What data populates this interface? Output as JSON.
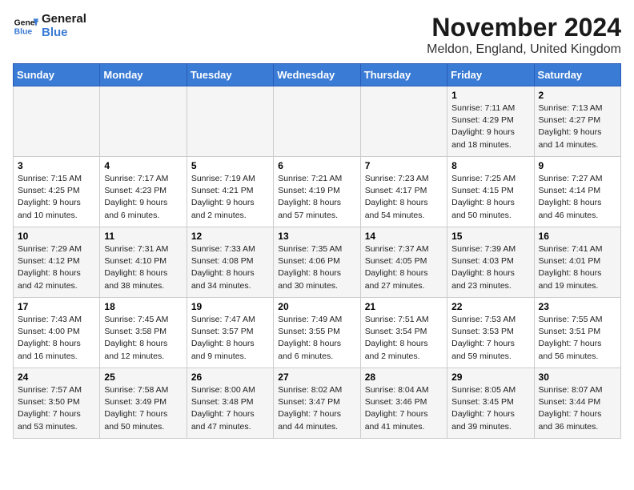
{
  "header": {
    "logo_line1": "General",
    "logo_line2": "Blue",
    "month": "November 2024",
    "location": "Meldon, England, United Kingdom"
  },
  "days_of_week": [
    "Sunday",
    "Monday",
    "Tuesday",
    "Wednesday",
    "Thursday",
    "Friday",
    "Saturday"
  ],
  "weeks": [
    [
      {
        "day": "",
        "info": ""
      },
      {
        "day": "",
        "info": ""
      },
      {
        "day": "",
        "info": ""
      },
      {
        "day": "",
        "info": ""
      },
      {
        "day": "",
        "info": ""
      },
      {
        "day": "1",
        "info": "Sunrise: 7:11 AM\nSunset: 4:29 PM\nDaylight: 9 hours\nand 18 minutes."
      },
      {
        "day": "2",
        "info": "Sunrise: 7:13 AM\nSunset: 4:27 PM\nDaylight: 9 hours\nand 14 minutes."
      }
    ],
    [
      {
        "day": "3",
        "info": "Sunrise: 7:15 AM\nSunset: 4:25 PM\nDaylight: 9 hours\nand 10 minutes."
      },
      {
        "day": "4",
        "info": "Sunrise: 7:17 AM\nSunset: 4:23 PM\nDaylight: 9 hours\nand 6 minutes."
      },
      {
        "day": "5",
        "info": "Sunrise: 7:19 AM\nSunset: 4:21 PM\nDaylight: 9 hours\nand 2 minutes."
      },
      {
        "day": "6",
        "info": "Sunrise: 7:21 AM\nSunset: 4:19 PM\nDaylight: 8 hours\nand 57 minutes."
      },
      {
        "day": "7",
        "info": "Sunrise: 7:23 AM\nSunset: 4:17 PM\nDaylight: 8 hours\nand 54 minutes."
      },
      {
        "day": "8",
        "info": "Sunrise: 7:25 AM\nSunset: 4:15 PM\nDaylight: 8 hours\nand 50 minutes."
      },
      {
        "day": "9",
        "info": "Sunrise: 7:27 AM\nSunset: 4:14 PM\nDaylight: 8 hours\nand 46 minutes."
      }
    ],
    [
      {
        "day": "10",
        "info": "Sunrise: 7:29 AM\nSunset: 4:12 PM\nDaylight: 8 hours\nand 42 minutes."
      },
      {
        "day": "11",
        "info": "Sunrise: 7:31 AM\nSunset: 4:10 PM\nDaylight: 8 hours\nand 38 minutes."
      },
      {
        "day": "12",
        "info": "Sunrise: 7:33 AM\nSunset: 4:08 PM\nDaylight: 8 hours\nand 34 minutes."
      },
      {
        "day": "13",
        "info": "Sunrise: 7:35 AM\nSunset: 4:06 PM\nDaylight: 8 hours\nand 30 minutes."
      },
      {
        "day": "14",
        "info": "Sunrise: 7:37 AM\nSunset: 4:05 PM\nDaylight: 8 hours\nand 27 minutes."
      },
      {
        "day": "15",
        "info": "Sunrise: 7:39 AM\nSunset: 4:03 PM\nDaylight: 8 hours\nand 23 minutes."
      },
      {
        "day": "16",
        "info": "Sunrise: 7:41 AM\nSunset: 4:01 PM\nDaylight: 8 hours\nand 19 minutes."
      }
    ],
    [
      {
        "day": "17",
        "info": "Sunrise: 7:43 AM\nSunset: 4:00 PM\nDaylight: 8 hours\nand 16 minutes."
      },
      {
        "day": "18",
        "info": "Sunrise: 7:45 AM\nSunset: 3:58 PM\nDaylight: 8 hours\nand 12 minutes."
      },
      {
        "day": "19",
        "info": "Sunrise: 7:47 AM\nSunset: 3:57 PM\nDaylight: 8 hours\nand 9 minutes."
      },
      {
        "day": "20",
        "info": "Sunrise: 7:49 AM\nSunset: 3:55 PM\nDaylight: 8 hours\nand 6 minutes."
      },
      {
        "day": "21",
        "info": "Sunrise: 7:51 AM\nSunset: 3:54 PM\nDaylight: 8 hours\nand 2 minutes."
      },
      {
        "day": "22",
        "info": "Sunrise: 7:53 AM\nSunset: 3:53 PM\nDaylight: 7 hours\nand 59 minutes."
      },
      {
        "day": "23",
        "info": "Sunrise: 7:55 AM\nSunset: 3:51 PM\nDaylight: 7 hours\nand 56 minutes."
      }
    ],
    [
      {
        "day": "24",
        "info": "Sunrise: 7:57 AM\nSunset: 3:50 PM\nDaylight: 7 hours\nand 53 minutes."
      },
      {
        "day": "25",
        "info": "Sunrise: 7:58 AM\nSunset: 3:49 PM\nDaylight: 7 hours\nand 50 minutes."
      },
      {
        "day": "26",
        "info": "Sunrise: 8:00 AM\nSunset: 3:48 PM\nDaylight: 7 hours\nand 47 minutes."
      },
      {
        "day": "27",
        "info": "Sunrise: 8:02 AM\nSunset: 3:47 PM\nDaylight: 7 hours\nand 44 minutes."
      },
      {
        "day": "28",
        "info": "Sunrise: 8:04 AM\nSunset: 3:46 PM\nDaylight: 7 hours\nand 41 minutes."
      },
      {
        "day": "29",
        "info": "Sunrise: 8:05 AM\nSunset: 3:45 PM\nDaylight: 7 hours\nand 39 minutes."
      },
      {
        "day": "30",
        "info": "Sunrise: 8:07 AM\nSunset: 3:44 PM\nDaylight: 7 hours\nand 36 minutes."
      }
    ]
  ]
}
